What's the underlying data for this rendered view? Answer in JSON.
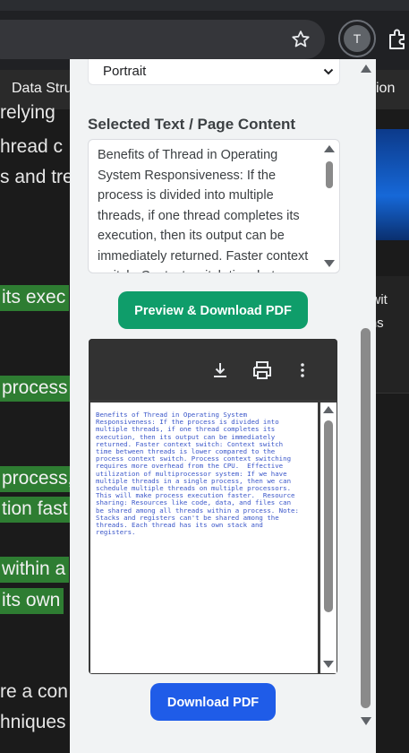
{
  "browser": {
    "profile_initial": "T"
  },
  "background_page": {
    "nav_left": "Data Stru",
    "nav_right": "ion",
    "lines": [
      {
        "text": "relying",
        "highlight": false
      },
      {
        "text": "hread  c",
        "highlight": false
      },
      {
        "text": "s and tre",
        "highlight": false
      },
      {
        "text": "its exec",
        "highlight": true
      },
      {
        "text": "process",
        "highlight": true
      },
      {
        "text": "process,",
        "highlight": true
      },
      {
        "text": "tion fast",
        "highlight": true
      },
      {
        "text": " within a",
        "highlight": true
      },
      {
        "text": " its own",
        "highlight": true
      },
      {
        "text": "re a con",
        "highlight": false
      },
      {
        "text": "hniques",
        "highlight": false
      }
    ],
    "side_lines": [
      "er wit",
      "tions"
    ]
  },
  "popup": {
    "orientation_select": {
      "value": "Portrait",
      "options": [
        "Portrait"
      ]
    },
    "selected_text_heading": "Selected Text / Page Content",
    "selected_text": "Benefits of Thread in Operating System Responsiveness: If the process is divided into multiple threads, if one thread completes its execution, then its output can be immediately returned. Faster context switch: Context switch time between threads is lower compared to the process context switch.",
    "preview_button": "Preview & Download PDF",
    "pdf_preview_text": "Benefits of Thread in Operating System\nResponsiveness: If the process is divided into\nmultiple threads, if one thread completes its\nexecution, then its output can be immediately\nreturned. Faster context switch: Context switch\ntime between threads is lower compared to the\nprocess context switch. Process context switching\nrequires more overhead from the CPU.  Effective\nutilization of multiprocessor system: If we have\nmultiple threads in a single process, then we can\nschedule multiple threads on multiple processors.\nThis will make process execution faster.  Resource\nsharing: Resources like code, data, and files can\nbe shared among all threads within a process. Note:\nStacks and registers can't be shared among the\nthreads. Each thread has its own stack and\nregisters.",
    "download_button": "Download PDF"
  },
  "icons": {
    "star": "star-icon",
    "extensions": "puzzle-icon",
    "viewer_download": "download-icon",
    "viewer_print": "print-icon",
    "viewer_more": "more-vert-icon"
  },
  "colors": {
    "preview_button": "#0f9d6a",
    "download_button": "#1f5ce8",
    "highlight": "#2e7d32",
    "pdf_text": "#3b57c9"
  }
}
